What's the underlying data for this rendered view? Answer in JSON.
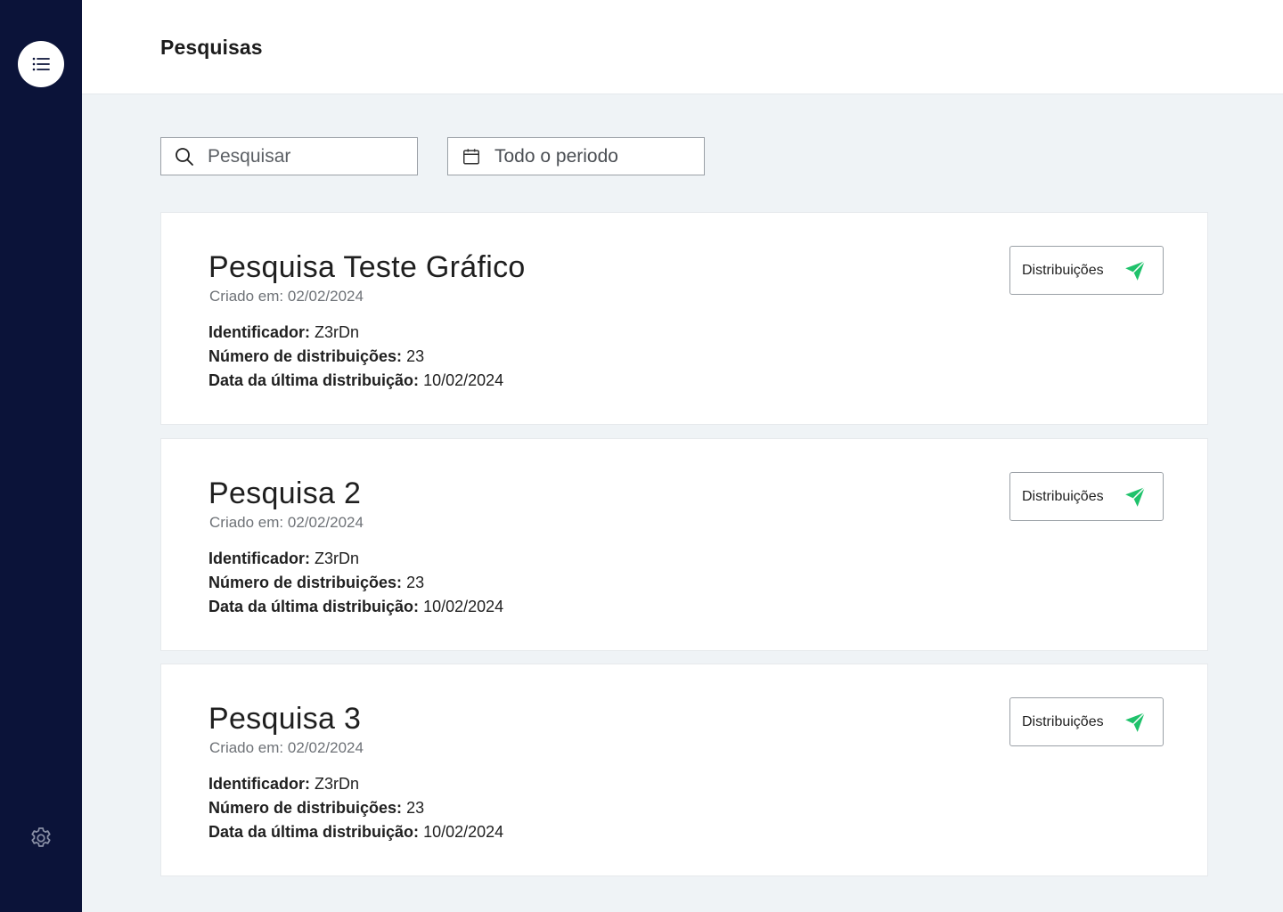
{
  "header": {
    "title": "Pesquisas"
  },
  "filters": {
    "search_placeholder": "Pesquisar",
    "period_label": "Todo o periodo"
  },
  "labels": {
    "created_prefix": "Criado em:",
    "identifier": "Identificador:",
    "distributions_count": "Número de distribuições:",
    "last_distribution": "Data da última distribuição:",
    "distributions_button": "Distribuições"
  },
  "surveys": [
    {
      "title": "Pesquisa Teste Gráfico",
      "created": "Criado em: 02/02/2024",
      "identifier": "Z3rDn",
      "distributions": "23",
      "last_distribution": "10/02/2024"
    },
    {
      "title": "Pesquisa 2",
      "created": "Criado em: 02/02/2024",
      "identifier": "Z3rDn",
      "distributions": "23",
      "last_distribution": "10/02/2024"
    },
    {
      "title": "Pesquisa 3",
      "created": "Criado em: 02/02/2024",
      "identifier": "Z3rDn",
      "distributions": "23",
      "last_distribution": "10/02/2024"
    }
  ],
  "colors": {
    "sidebar": "#0b1339",
    "accent_send": "#1fc26b",
    "background": "#eff3f6"
  },
  "icons": {
    "menu": "list-icon",
    "settings": "gear-icon",
    "search": "search-icon",
    "calendar": "calendar-icon",
    "send": "send-icon"
  }
}
